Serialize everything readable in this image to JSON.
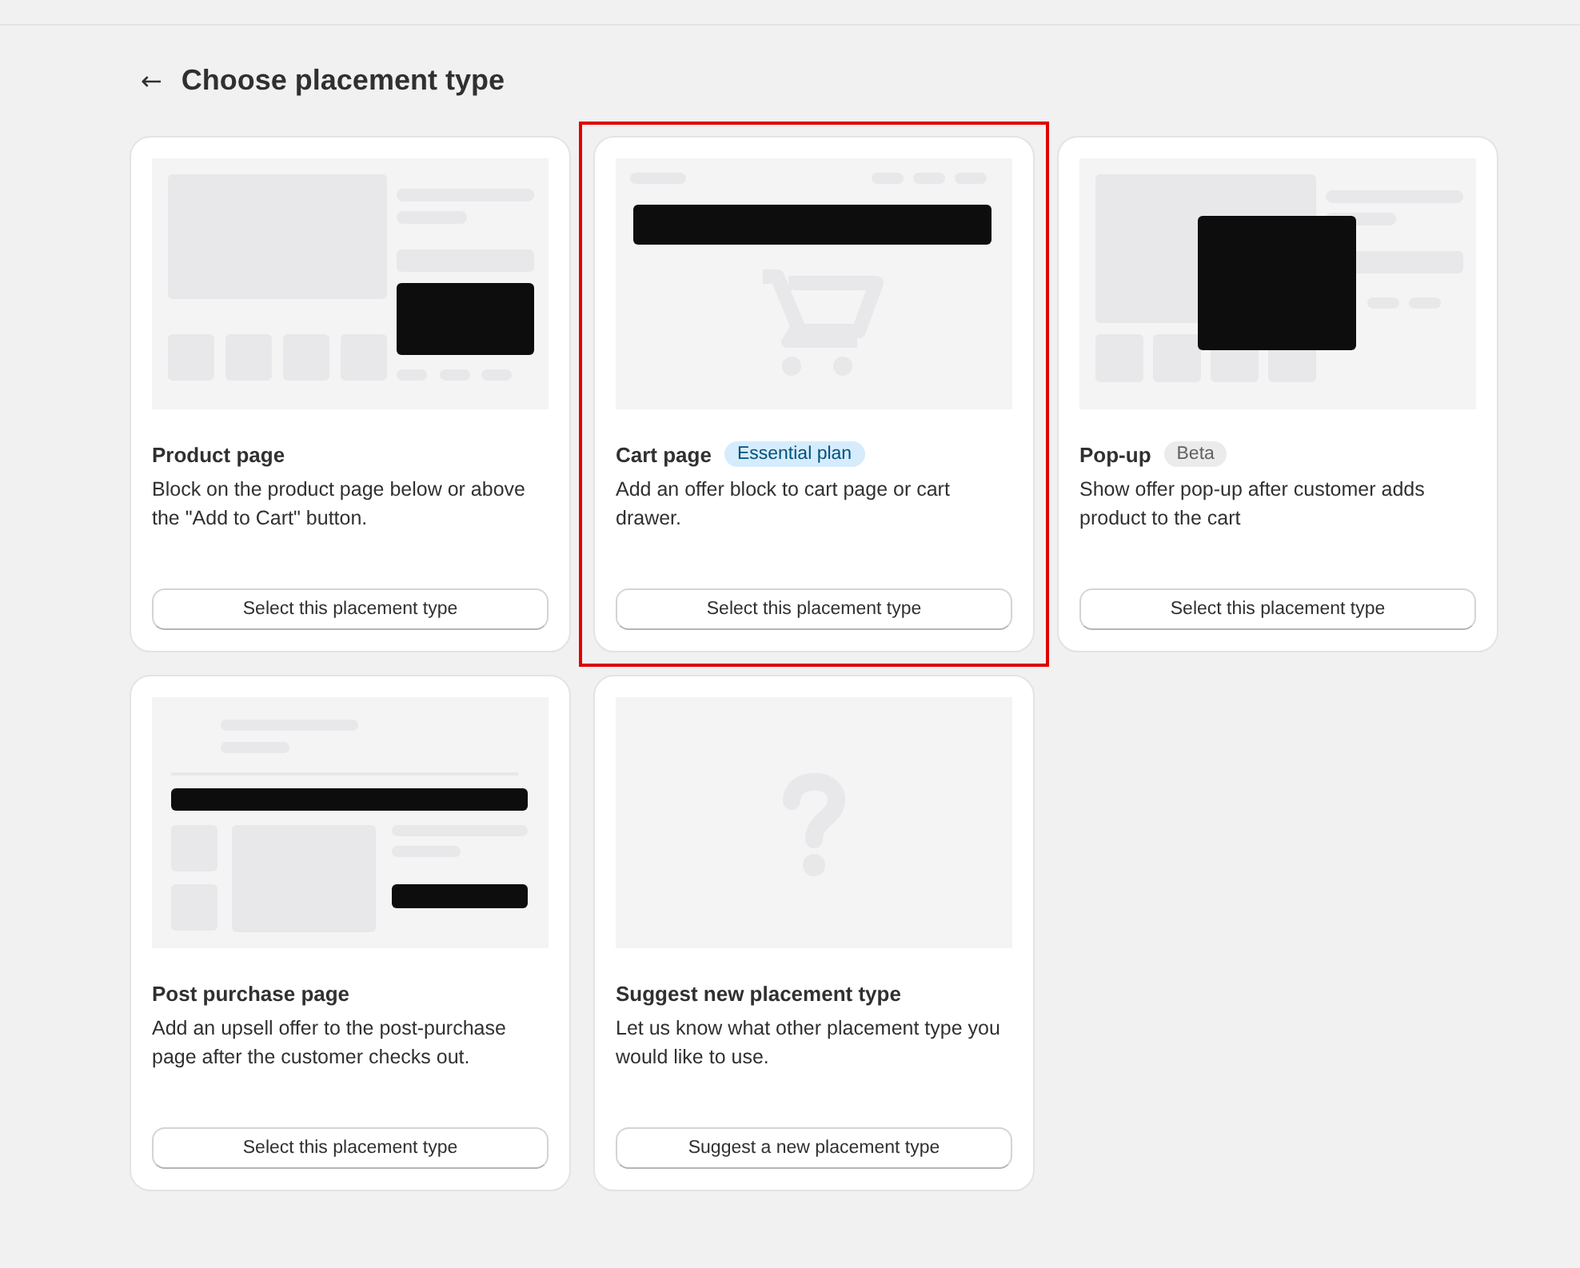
{
  "header": {
    "back_icon": "←",
    "title": "Choose placement type"
  },
  "cards": [
    {
      "kind": "product",
      "title": "Product page",
      "description": "Block on the product page below or above the \"Add to Cart\" button.",
      "action": "Select this placement type",
      "selected": false
    },
    {
      "kind": "cart",
      "title": "Cart page",
      "badge": {
        "label": "Essential plan",
        "kind": "info"
      },
      "description": "Add an offer block to cart page or cart drawer.",
      "action": "Select this placement type",
      "selected": true
    },
    {
      "kind": "popup",
      "title": "Pop-up",
      "badge": {
        "label": "Beta",
        "kind": "neutral"
      },
      "description": "Show offer pop-up after customer adds product to the cart",
      "action": "Select this placement type",
      "selected": false
    },
    {
      "kind": "post_purchase",
      "title": "Post purchase page",
      "description": "Add an upsell offer to the post-purchase page after the customer checks out.",
      "action": "Select this placement type",
      "selected": false
    },
    {
      "kind": "suggest",
      "title": "Suggest new placement type",
      "description": "Let us know what other placement type you would like to use.",
      "action": "Suggest a new placement type",
      "selected": false
    }
  ]
}
